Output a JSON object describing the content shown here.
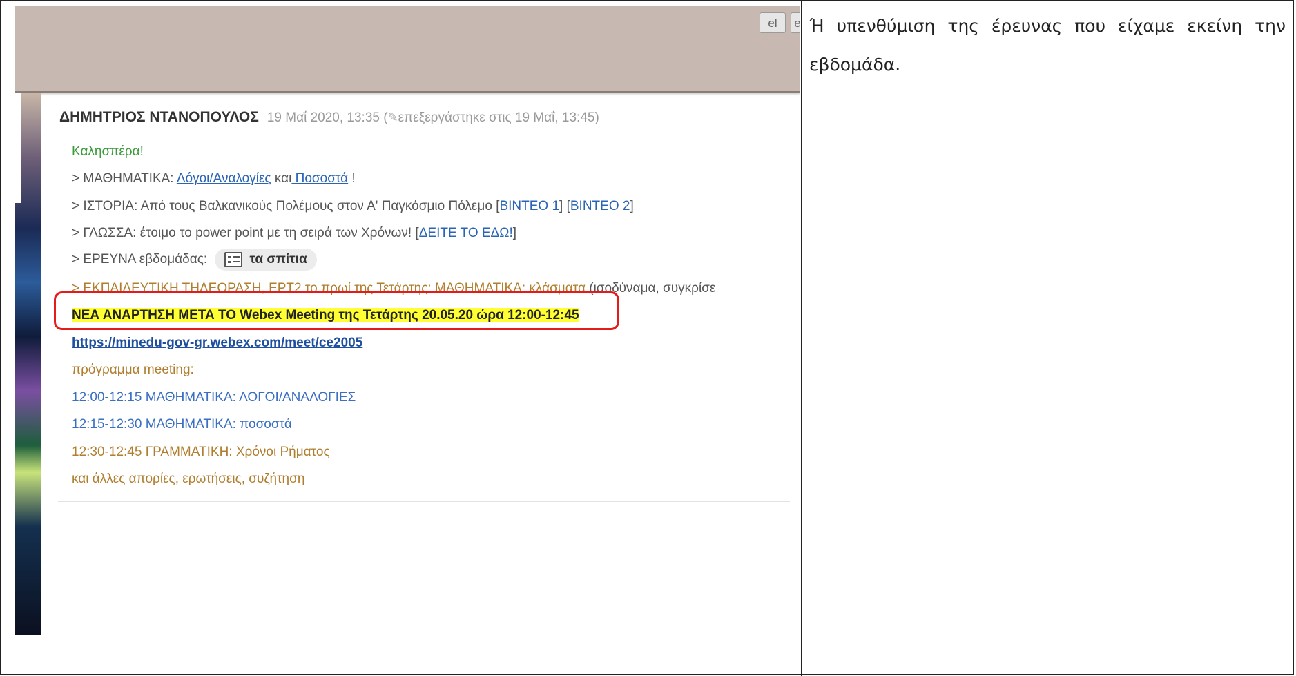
{
  "lang": {
    "primary": "el",
    "secondary": "e"
  },
  "post": {
    "author": "ΔΗΜΗΤΡΙΟΣ ΝΤΑΝΟΠΟΥΛΟΣ",
    "timestamp": "19 Μαΐ 2020, 13:35 (",
    "edited": "επεξεργάστηκε στις 19 Μαΐ, 13:45)"
  },
  "content": {
    "greeting": "Καλησπέρα!",
    "math_prefix": "> ΜΑΘΗΜΑΤΙΚΑ: ",
    "math_link1": "Λόγοι/Αναλογίες",
    "math_mid": " και",
    "math_link2": " Ποσοστά",
    "math_suffix": " !",
    "history_prefix": "> ΙΣΤΟΡΙΑ: Από τους Βαλκανικούς Πολέμους στον Α' Παγκόσμιο Πόλεμο   [",
    "history_link1": "ΒΙΝΤΕΟ 1",
    "history_mid": "] [",
    "history_link2": "ΒΙΝΤΕΟ 2",
    "history_suffix": "]",
    "language_prefix": "> ΓΛΩΣΣΑ: έτοιμο το power point με τη σειρά των Χρόνων! [",
    "language_link": "ΔΕΙΤΕ ΤΟ ΕΔΩ!",
    "language_suffix": "]",
    "survey_prefix": "> ΕΡΕΥΝΑ εβδομάδας: ",
    "survey_chip": "τα σπίτια",
    "tv_prefix": "> ΕΚΠΑΙΔΕΥΤΙΚΗ ΤΗΛΕΟΡΑΣΗ, ΕΡΤ2 το πρωί της Τετάρτης: ΜΑΘΗΜΑΤΙΚΑ: κλάσματα ",
    "tv_suffix": "(ισοδύναμα, συγκρίσε",
    "announcement": "ΝΕΑ ΑΝΑΡΤΗΣΗ ΜΕΤΑ ΤΟ Webex Meeting της Τετάρτης 20.05.20 ώρα 12:00-12:45",
    "webex_link": "https://minedu-gov-gr.webex.com/meet/ce2005",
    "program_label": "πρόγραμμα meeting:",
    "slot1": "12:00-12:15 ΜΑΘΗΜΑΤΙΚΑ: ΛΟΓΟΙ/ΑΝΑΛΟΓΙΕΣ",
    "slot2": "12:15-12:30 ΜΑΘΗΜΑΤΙΚΑ: ποσοστά",
    "slot3": "12:30-12:45 ΓΡΑΜΜΑΤΙΚΗ: Χρόνοι Ρήματος",
    "closing": "και άλλες απορίες, ερωτήσεις, συζήτηση"
  },
  "caption": "Ή υπενθύμιση της έρευνας που είχαμε εκείνη την εβδομάδα."
}
